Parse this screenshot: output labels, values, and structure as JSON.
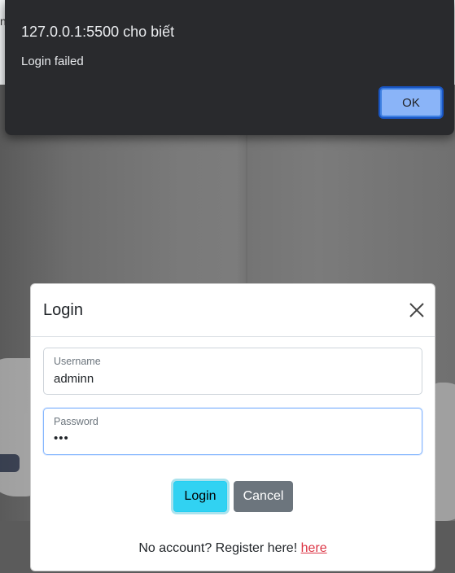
{
  "background": {
    "cut_text": "n"
  },
  "alert": {
    "origin": "127.0.0.1:5500 cho biết",
    "message": "Login failed",
    "ok_label": "OK"
  },
  "modal": {
    "title": "Login",
    "close_icon": "close-icon",
    "username": {
      "label": "Username",
      "value": "adminn"
    },
    "password": {
      "label": "Password",
      "value": "•••"
    },
    "login_label": "Login",
    "cancel_label": "Cancel",
    "register_text": "No account? Register here! ",
    "register_link": "here"
  },
  "colors": {
    "alert_bg": "#292a2d",
    "ok_button": "#8ab4f8",
    "login_button": "#31d2f2",
    "cancel_button": "#6c757d",
    "link": "#dc3545"
  }
}
